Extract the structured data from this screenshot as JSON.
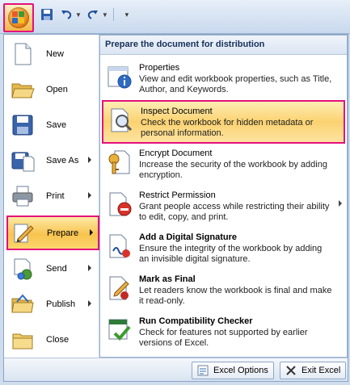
{
  "colors": {
    "highlight_border": "#e3107c",
    "selected_bg": "#f8c44f",
    "panel_header_text": "#15305a"
  },
  "qat": {
    "icons": [
      "office-button-icon",
      "save-icon",
      "undo-icon",
      "redo-icon",
      "customize-qat-icon"
    ]
  },
  "left_menu": {
    "items": [
      {
        "id": "new",
        "label": "New",
        "icon": "new-document-icon",
        "has_submenu": false
      },
      {
        "id": "open",
        "label": "Open",
        "icon": "open-folder-icon",
        "has_submenu": false
      },
      {
        "id": "save",
        "label": "Save",
        "icon": "save-disk-icon",
        "has_submenu": false
      },
      {
        "id": "save-as",
        "label": "Save As",
        "icon": "save-as-icon",
        "has_submenu": true
      },
      {
        "id": "print",
        "label": "Print",
        "icon": "printer-icon",
        "has_submenu": true
      },
      {
        "id": "prepare",
        "label": "Prepare",
        "icon": "prepare-pencil-icon",
        "has_submenu": true,
        "selected": true
      },
      {
        "id": "send",
        "label": "Send",
        "icon": "send-mail-icon",
        "has_submenu": true
      },
      {
        "id": "publish",
        "label": "Publish",
        "icon": "publish-folder-icon",
        "has_submenu": true
      },
      {
        "id": "close",
        "label": "Close",
        "icon": "close-folder-icon",
        "has_submenu": false
      }
    ]
  },
  "prepare_panel": {
    "header": "Prepare the document for distribution",
    "items": [
      {
        "id": "properties",
        "title": "Properties",
        "desc": "View and edit workbook properties, such as Title, Author, and Keywords.",
        "icon": "properties-icon",
        "bold": false,
        "selected": false,
        "has_submenu": false
      },
      {
        "id": "inspect-document",
        "title": "Inspect Document",
        "desc": "Check the workbook for hidden metadata or personal information.",
        "icon": "inspect-document-icon",
        "bold": false,
        "selected": true,
        "has_submenu": false
      },
      {
        "id": "encrypt-document",
        "title": "Encrypt Document",
        "desc": "Increase the security of the workbook by adding encryption.",
        "icon": "encrypt-key-icon",
        "bold": false,
        "selected": false,
        "has_submenu": false
      },
      {
        "id": "restrict-permission",
        "title": "Restrict Permission",
        "desc": "Grant people access while restricting their ability to edit, copy, and print.",
        "icon": "restrict-permission-icon",
        "bold": false,
        "selected": false,
        "has_submenu": true
      },
      {
        "id": "add-digital-signature",
        "title": "Add a Digital Signature",
        "desc": "Ensure the integrity of the workbook by adding an invisible digital signature.",
        "icon": "digital-signature-icon",
        "bold": true,
        "selected": false,
        "has_submenu": false
      },
      {
        "id": "mark-as-final",
        "title": "Mark as Final",
        "desc": "Let readers know the workbook is final and make it read-only.",
        "icon": "mark-final-icon",
        "bold": false,
        "selected": false,
        "has_submenu": false
      },
      {
        "id": "run-compatibility-checker",
        "title": "Run Compatibility Checker",
        "desc": "Check for features not supported by earlier versions of Excel.",
        "icon": "compatibility-checker-icon",
        "bold": true,
        "selected": false,
        "has_submenu": false
      }
    ]
  },
  "footer": {
    "options_label": "Excel Options",
    "exit_label": "Exit Excel"
  }
}
